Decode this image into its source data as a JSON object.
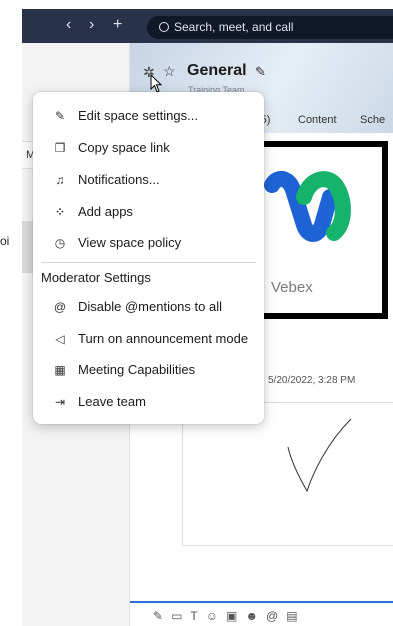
{
  "nav": {
    "back": "‹",
    "forward": "›",
    "new": "+"
  },
  "search": {
    "placeholder": "Search, meet, and call"
  },
  "sidebar": {
    "label_fragment": "M",
    "text_fragment": "oi"
  },
  "space": {
    "title": "General",
    "subtitle": "Training Team"
  },
  "tabs": [
    {
      "label": "(5)"
    },
    {
      "label": "Content"
    },
    {
      "label": "Sche"
    }
  ],
  "content": {
    "video_brand": "Vebex",
    "timestamp": "5/20/2022, 3:28 PM"
  },
  "menu": {
    "items": [
      {
        "label": "Edit space settings...",
        "icon": "pencil-icon"
      },
      {
        "label": "Copy space link",
        "icon": "copy-icon"
      },
      {
        "label": "Notifications...",
        "icon": "bell-icon"
      },
      {
        "label": "Add apps",
        "icon": "apps-icon"
      },
      {
        "label": "View space policy",
        "icon": "policy-icon"
      }
    ],
    "section_title": "Moderator Settings",
    "moderator_items": [
      {
        "label": "Disable @mentions to all",
        "icon": "at-icon"
      },
      {
        "label": "Turn on announcement mode",
        "icon": "megaphone-icon"
      },
      {
        "label": "Meeting Capabilities",
        "icon": "calendar-icon"
      },
      {
        "label": "Leave team",
        "icon": "leave-icon"
      }
    ]
  },
  "colors": {
    "topbar": "#283349",
    "accent": "#2d72d9"
  }
}
